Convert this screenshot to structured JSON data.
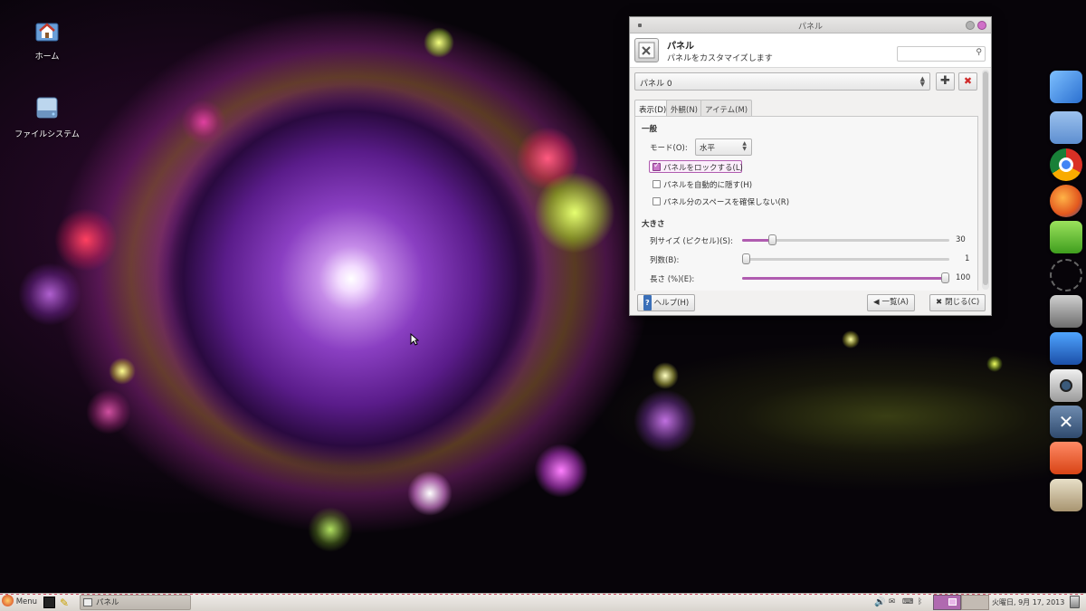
{
  "desktop": {
    "icons": [
      {
        "label": "ホーム",
        "icon": "home-folder-icon"
      },
      {
        "label": "ファイルシステム",
        "icon": "drive-icon"
      }
    ]
  },
  "dock": {
    "items": [
      "finder-icon",
      "folder-icon",
      "chrome-icon",
      "firefox-icon",
      "notes-icon",
      "clock-icon",
      "gimp-icon",
      "draw-icon",
      "camera-icon",
      "tools-icon",
      "app-store-icon",
      "installer-icon"
    ]
  },
  "dialog": {
    "window_title": "パネル",
    "header": {
      "title": "パネル",
      "subtitle": "パネルをカスタマイズします",
      "search_placeholder": ""
    },
    "panel_combo": {
      "value": "パネル 0"
    },
    "add_button": "✚",
    "remove_button": "✖",
    "tabs": [
      {
        "label": "表示(D)",
        "active": true
      },
      {
        "label": "外観(N)",
        "active": false
      },
      {
        "label": "アイテム(M)",
        "active": false
      }
    ],
    "general": {
      "section": "一般",
      "mode_label": "モード(O):",
      "mode_value": "水平",
      "lock_label": "パネルをロックする(L)",
      "lock_checked": true,
      "autohide_label": "パネルを自動的に隠す(H)",
      "autohide_checked": false,
      "reserve_label": "パネル分のスペースを確保しない(R)",
      "reserve_checked": false
    },
    "size": {
      "section": "大きさ",
      "row_size_label": "列サイズ (ピクセル)(S):",
      "row_size_value": "30",
      "row_size_fraction": 0.13,
      "rows_label": "列数(B):",
      "rows_value": "1",
      "rows_fraction": 0.0,
      "length_label": "長さ (%)(E):",
      "length_value": "100",
      "length_fraction": 1.0
    },
    "buttons": {
      "help": "ヘルプ(H)",
      "add": "一覧(A)",
      "close": "閉じる(C)"
    }
  },
  "taskbar": {
    "menu_label": "Menu",
    "window_label": "パネル",
    "clock": "火曜日, 9月 17, 2013"
  },
  "colors": {
    "accent": "#b05cb0",
    "close_button": "#d070c8"
  }
}
